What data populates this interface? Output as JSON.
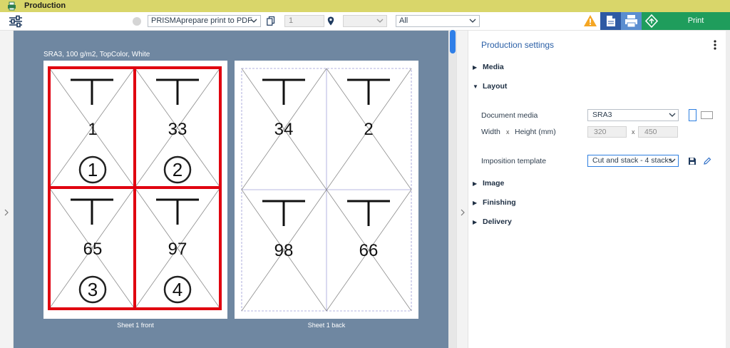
{
  "window": {
    "title": "Production"
  },
  "toolbar": {
    "workflow_select": "PRISMAprepare print to PDF",
    "copies_value": "1",
    "location_select": "",
    "pages_select": "All",
    "print_label": "Print",
    "colors": {
      "doc_button": "#2e5aa4",
      "printer_button": "#5b8ed0",
      "print_button": "#1f9d5c",
      "warning": "#f5a623"
    },
    "icons": [
      "settings-sliders-icon",
      "copy-icon",
      "location-pin-icon",
      "warning-icon",
      "document-icon",
      "printer-icon",
      "job-ticket-icon"
    ]
  },
  "canvas": {
    "caption": "SRA3, 100 g/m2, TopColor, White",
    "background": "#6f87a1",
    "sheets": [
      {
        "label": "Sheet 1 front",
        "pages": [
          {
            "number": "1",
            "stack": "1"
          },
          {
            "number": "33",
            "stack": "2"
          },
          {
            "number": "65",
            "stack": "3"
          },
          {
            "number": "97",
            "stack": "4"
          }
        ]
      },
      {
        "label": "Sheet 1 back",
        "pages": [
          {
            "number": "34"
          },
          {
            "number": "2"
          },
          {
            "number": "98"
          },
          {
            "number": "66"
          }
        ]
      }
    ]
  },
  "panel": {
    "title": "Production settings",
    "sections": {
      "media": "Media",
      "layout": "Layout",
      "image": "Image",
      "finishing": "Finishing",
      "delivery": "Delivery"
    },
    "layout": {
      "document_media_label": "Document media",
      "document_media_value": "SRA3",
      "width_label": "Width",
      "x_label": "x",
      "height_label": "Height (mm)",
      "width_value": "320",
      "height_value": "450",
      "imposition_label": "Imposition template",
      "imposition_value": "Cut and stack - 4 stacks"
    }
  }
}
